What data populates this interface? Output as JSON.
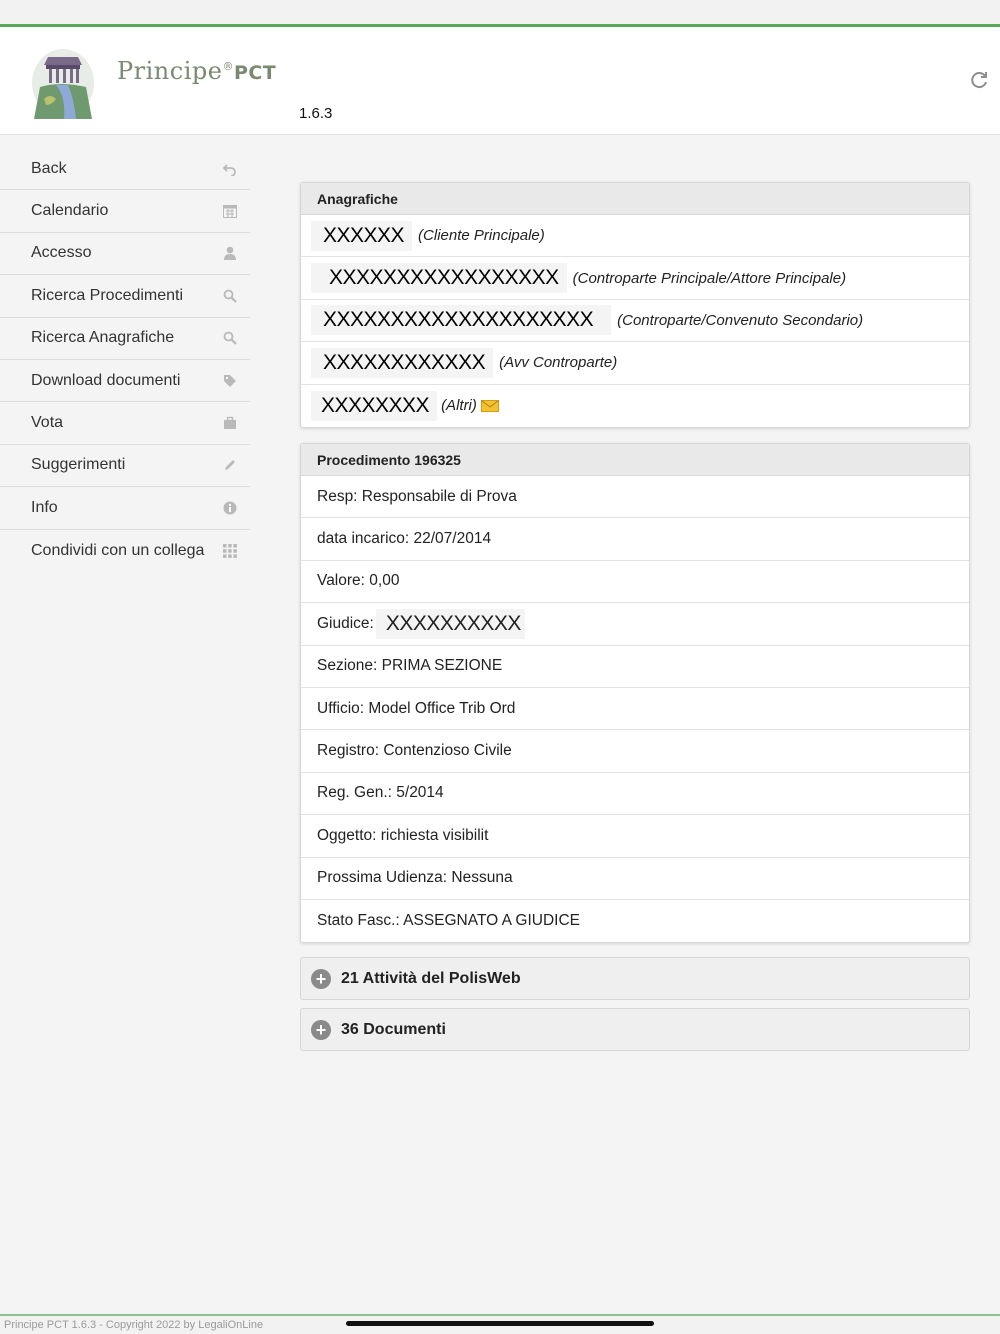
{
  "header": {
    "brand_name": "Principe",
    "brand_reg": "®",
    "brand_suffix": "PCT",
    "version": "1.6.3",
    "refresh_icon": "refresh-icon",
    "accent_color": "#5aa85a"
  },
  "sidebar": {
    "items": [
      {
        "label": "Back",
        "icon": "undo-icon"
      },
      {
        "label": "Calendario",
        "icon": "calendar-icon"
      },
      {
        "label": "Accesso",
        "icon": "user-icon"
      },
      {
        "label": "Ricerca Procedimenti",
        "icon": "search-icon"
      },
      {
        "label": "Ricerca Anagrafiche",
        "icon": "search-icon"
      },
      {
        "label": "Download documenti",
        "icon": "tag-icon"
      },
      {
        "label": "Vota",
        "icon": "briefcase-icon"
      },
      {
        "label": "Suggerimenti",
        "icon": "pencil-icon"
      },
      {
        "label": "Info",
        "icon": "info-icon"
      },
      {
        "label": "Condividi con un collega",
        "icon": "grid-icon"
      }
    ]
  },
  "anagrafiche": {
    "title": "Anagrafiche",
    "rows": [
      {
        "name": "XXXXXX",
        "role": "(Cliente Principale)"
      },
      {
        "name": "XXXXXXXXXXXXXXXXX",
        "role": "(Controparte Principale/Attore Principale)"
      },
      {
        "name": "XXXXXXXXXXXXXXXXXXXX",
        "role": "(Controparte/Convenuto Secondario)"
      },
      {
        "name": "XXXXXXXXXXXX",
        "role": "(Avv Controparte)"
      },
      {
        "name": "XXXXXXXX",
        "role": "(Altri)",
        "icon": "envelope-icon"
      }
    ]
  },
  "procedimento": {
    "title": "Procedimento 196325",
    "rows": [
      "Resp: Responsabile di Prova",
      "data incarico: 22/07/2014",
      "Valore: 0,00"
    ],
    "giudice_label": "Giudice:",
    "giudice_value": "XXXXXXXXXX",
    "rows_after": [
      "Sezione: PRIMA SEZIONE",
      "Ufficio: Model Office Trib Ord",
      "Registro: Contenzioso Civile",
      "Reg. Gen.: 5/2014",
      "Oggetto: richiesta visibilit",
      "Prossima Udienza: Nessuna",
      "Stato Fasc.: ASSEGNATO A GIUDICE"
    ]
  },
  "sections": {
    "attivita": "21 Attività del PolisWeb",
    "documenti": "36 Documenti"
  },
  "footer": {
    "text": "Principe PCT 1.6.3 - Copyright 2022 by LegaliOnLine"
  }
}
